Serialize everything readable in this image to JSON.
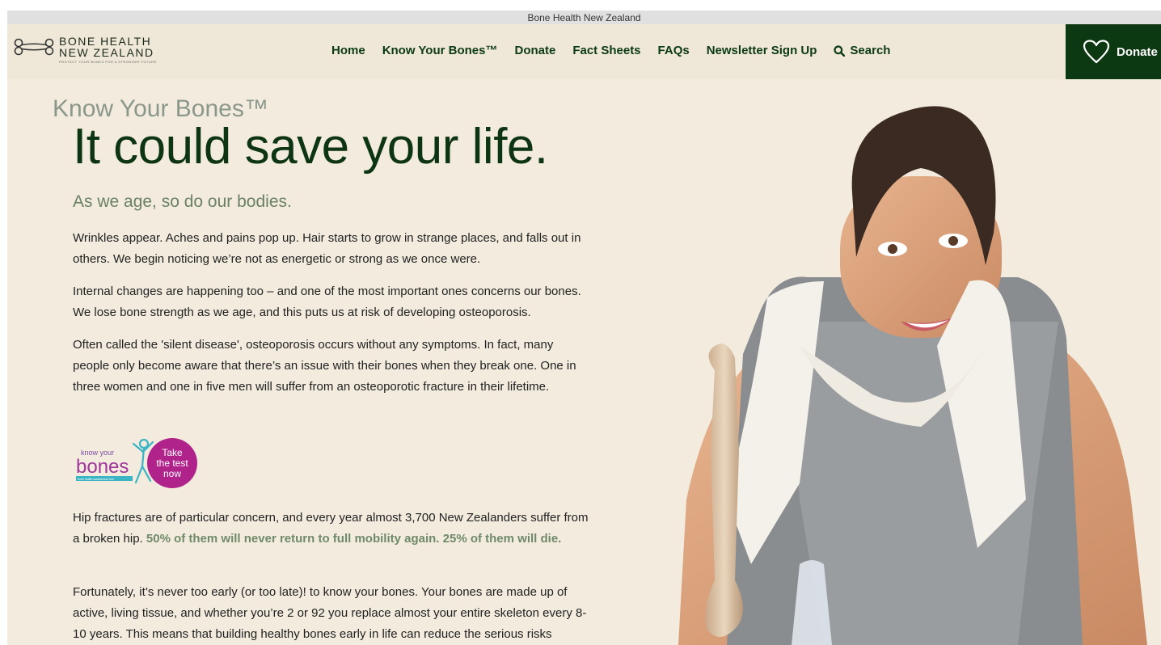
{
  "window": {
    "title": "Bone Health New Zealand"
  },
  "brand": {
    "line1": "BONE HEALTH",
    "line2": "NEW ZEALAND",
    "tagline": "PROTECT YOUR BONES FOR A STRONGER FUTURE"
  },
  "nav": {
    "items": [
      {
        "label": "Home"
      },
      {
        "label": "Know Your Bones™"
      },
      {
        "label": "Donate"
      },
      {
        "label": "Fact Sheets"
      },
      {
        "label": "FAQs"
      },
      {
        "label": "Newsletter Sign Up"
      }
    ],
    "search_label": "Search",
    "donate_button": "Donate"
  },
  "hero": {
    "overline": "Know Your Bones™",
    "title": "It could save your life.",
    "subtitle": "As we age, so do our bodies."
  },
  "body": {
    "p1": "Wrinkles appear. Aches and pains pop up. Hair starts to grow in strange places, and falls out in others. We begin noticing we’re not as energetic or strong as we once were.",
    "p2": "Internal changes are happening too – and one of the most important ones concerns our bones. We lose bone strength as we age, and this puts us at risk of developing osteoporosis.",
    "p3": "Often called the 'silent disease', osteoporosis occurs without any symptoms. In fact, many people only become aware that there’s an issue with their bones when they break one. One in three women and one in five men will suffer from an osteoporotic fracture in their lifetime.",
    "p4_start": "Hip fractures are of particular concern, and every year almost 3,700 New Zealanders suffer from a broken hip. ",
    "p4_bold": "50% of them will never return to full mobility again. 25% of them will die.",
    "p5": "Fortunately, it’s never too early (or too late)! to know your bones. Your bones are made up of active, living tissue, and whether you’re 2 or 92 you replace almost your entire skeleton every 8-10 years. This means that building healthy bones early in life can reduce the serious risks"
  },
  "badge": {
    "small": "know your",
    "big": "bones",
    "tag": "bone health assessment tool",
    "circle_line1": "Take",
    "circle_line2": "the test",
    "circle_line3": "now"
  },
  "colors": {
    "nav_text": "#0b3a13",
    "donate_bg": "#0c3812",
    "header_bg": "#efe8d8",
    "page_bg": "#f2ebde",
    "accent_green": "#708a69",
    "badge_purple": "#b0238a",
    "badge_teal": "#3bb5c4"
  },
  "icons": {
    "logo": "bone-logo-icon",
    "search": "search-icon",
    "donate": "heart-outline-icon"
  }
}
